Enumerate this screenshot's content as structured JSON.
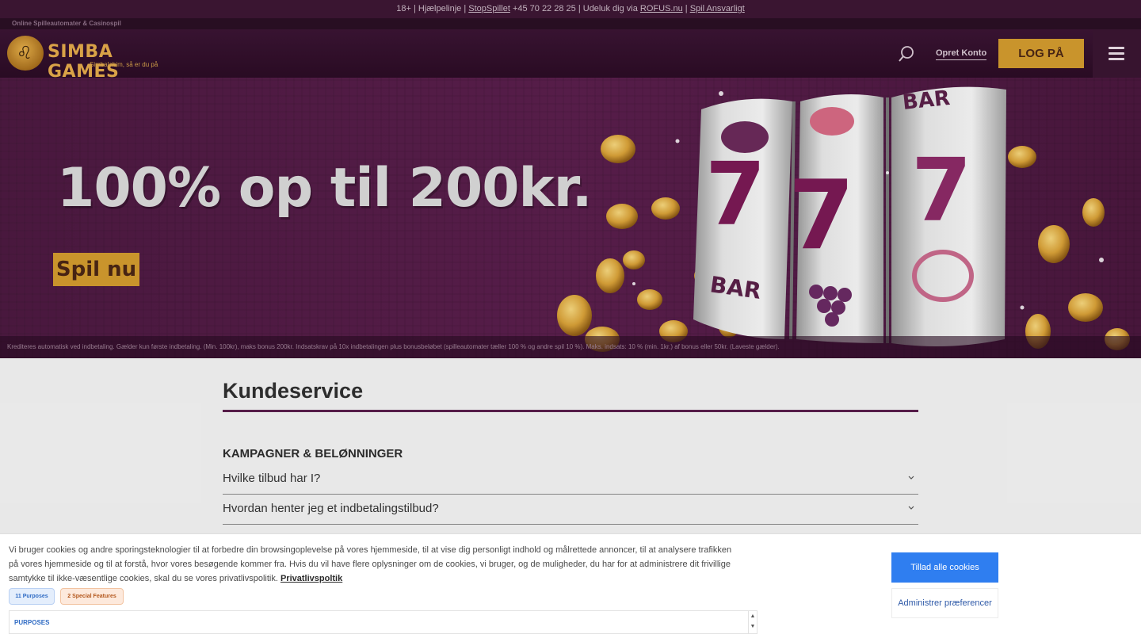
{
  "topbar": {
    "age": "18+",
    "sep": " | ",
    "helpline": "Hjælpelinje",
    "stopspillet": "StopSpillet",
    "phone": "+45 70 22 28 25",
    "exclude": "Udeluk dig via",
    "rofus": "ROFUS.nu",
    "responsible": "Spil Ansvarligt"
  },
  "subtag": "Online Spilleautomater & Casinospil",
  "header": {
    "logo_title": "SIMBA GAMES",
    "logo_sub": "Simbalabim, så er du på",
    "create_account": "Opret Konto",
    "login": "LOG PÅ"
  },
  "hero": {
    "title": "100% op til 200kr.",
    "cta": "Spil nu",
    "disclaimer": "Krediteres automatisk ved indbetaling. Gælder kun første indbetaling. (Min. 100kr), maks bonus 200kr. Indsatskrav på 10x indbetalingen plus bonusbeløbet (spilleautomater tæller 100 % og andre spil 10 %). Maks. indsats: 10 % (min. 1kr.) af bonus eller 50kr. (Laveste gælder).",
    "reel_text": "BAR",
    "seven": "7"
  },
  "main": {
    "title": "Kundeservice",
    "section": "KAMPAGNER & BELØNNINGER",
    "faq": [
      {
        "q": "Hvilke tilbud har I?"
      },
      {
        "q": "Hvordan henter jeg et indbetalingstilbud?"
      }
    ]
  },
  "cookie": {
    "text": "Vi bruger cookies og andre sporingsteknologier til at forbedre din browsingoplevelse på vores hjemmeside, til at vise dig personligt indhold og målrettede annoncer, til at analysere trafikken på vores hjemmeside og til at forstå, hvor vores besøgende kommer fra. Hvis du vil have flere oplysninger om de cookies, vi bruger, og de muligheder, du har for at administrere dit frivillige samtykke til ikke-væsentlige cookies, skal du se vores privatlivspolitik.",
    "policy_link": "Privatlivspoltik",
    "badge_purposes": "11 Purposes",
    "badge_special": "2 Special Features",
    "purposes_label": "PURPOSES",
    "allow_all": "Tillad alle cookies",
    "manage": "Administrer præferencer",
    "colors": {
      "accent": "#2f7ef0",
      "brand": "#d29b2e",
      "hero": "#5a1f4c"
    }
  }
}
